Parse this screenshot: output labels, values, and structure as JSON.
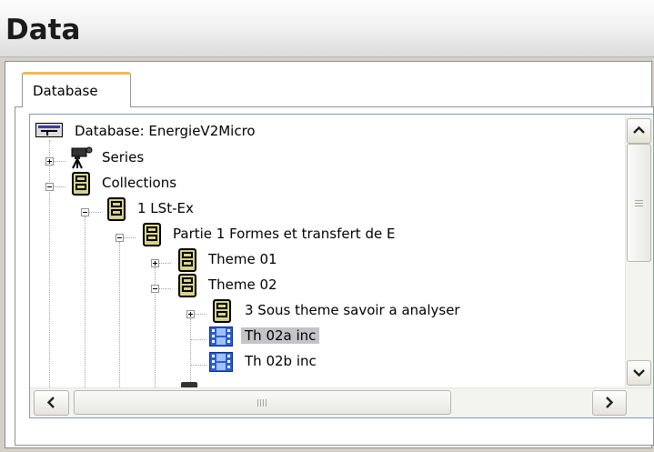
{
  "window": {
    "title": "Data"
  },
  "tabs": [
    {
      "label": "Database",
      "active": true
    }
  ],
  "tree": {
    "items": [
      {
        "label": "Database: EnergieV2Micro",
        "icon": "database-icon",
        "state": "none",
        "selected": false
      },
      {
        "label": "Series",
        "icon": "camera-icon",
        "state": "collapsed",
        "selected": false
      },
      {
        "label": "Collections",
        "icon": "file-cabinet-icon",
        "state": "expanded",
        "selected": false
      },
      {
        "label": "1 LSt-Ex",
        "icon": "file-cabinet-icon",
        "state": "expanded",
        "selected": false
      },
      {
        "label": "Partie 1 Formes et transfert de E",
        "icon": "file-cabinet-icon",
        "state": "expanded",
        "selected": false
      },
      {
        "label": "Theme 01",
        "icon": "file-cabinet-icon",
        "state": "collapsed",
        "selected": false
      },
      {
        "label": "Theme 02",
        "icon": "file-cabinet-icon",
        "state": "expanded",
        "selected": false
      },
      {
        "label": "3 Sous theme savoir a analyser",
        "icon": "file-cabinet-icon",
        "state": "collapsed",
        "selected": false
      },
      {
        "label": "Th 02a inc",
        "icon": "film-icon",
        "state": "none",
        "selected": true
      },
      {
        "label": "Th 02b inc",
        "icon": "film-icon",
        "state": "none",
        "selected": false
      }
    ]
  },
  "colors": {
    "tab_accent": "#f6b84b",
    "selection": "#c3c3c8",
    "film_icon": "#2b5fd0"
  }
}
